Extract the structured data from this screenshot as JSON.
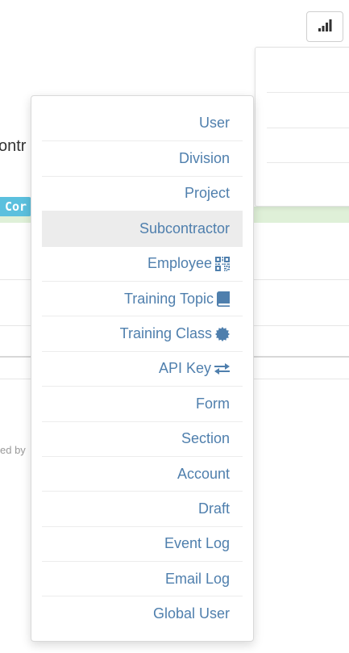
{
  "background": {
    "partial_title": "ontr",
    "tag_text": "Cor",
    "footer_partial": "ed by"
  },
  "menu": {
    "items": [
      {
        "label": "User"
      },
      {
        "label": "Division"
      },
      {
        "label": "Project"
      },
      {
        "label": "Subcontractor",
        "active": true
      },
      {
        "label": "Employee",
        "icon": "qrcode-icon"
      },
      {
        "label": "Training Topic",
        "icon": "book-icon"
      },
      {
        "label": "Training Class",
        "icon": "certificate-icon"
      },
      {
        "label": "API Key",
        "icon": "exchange-icon"
      },
      {
        "label": "Form"
      },
      {
        "label": "Section"
      },
      {
        "label": "Account"
      },
      {
        "label": "Draft"
      },
      {
        "label": "Event Log"
      },
      {
        "label": "Email Log"
      },
      {
        "label": "Global User"
      }
    ]
  },
  "toolbar": {
    "stats_icon": "signal-bars-icon"
  },
  "colors": {
    "link": "#4f7fad",
    "active_bg": "#ececec",
    "banner": "#dff0d8",
    "tag": "#5bc0de"
  }
}
